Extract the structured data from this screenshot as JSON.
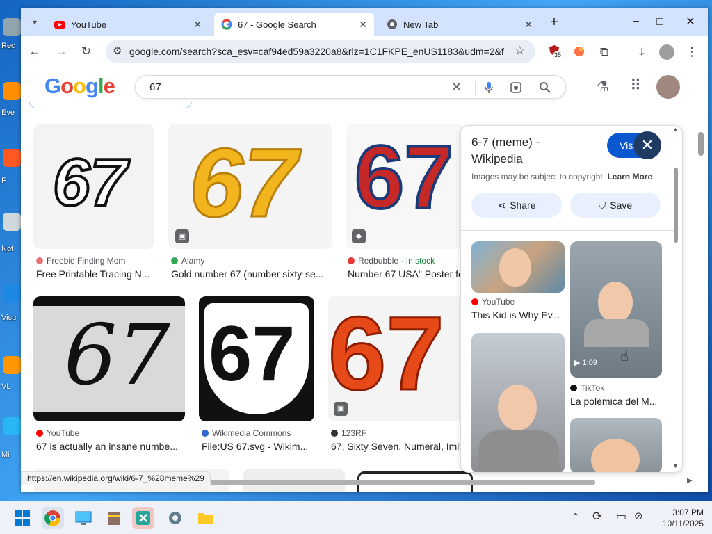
{
  "desktop": {
    "icons": [
      {
        "label": "Rec"
      },
      {
        "label": "Eve"
      },
      {
        "label": "F"
      },
      {
        "label": "Not"
      },
      {
        "label": "Visu"
      },
      {
        "label": "VL"
      },
      {
        "label": "Mi"
      }
    ]
  },
  "browser": {
    "tabs": [
      {
        "label": "YouTube"
      },
      {
        "label": "67 - Google Search"
      },
      {
        "label": "New Tab"
      }
    ],
    "new_tab_symbol": "+",
    "url": "google.com/search?sca_esv=caf94ed59a3220a8&rlz=1C1FKPE_enUS1183&udm=2&f...",
    "extension_badge": "35",
    "window_controls": {
      "minimize": "−",
      "maximize": "□",
      "close": "✕"
    }
  },
  "search": {
    "logo": "Google",
    "query": "67"
  },
  "results": [
    {
      "source": "Freebie Finding Mom",
      "title": "Free Printable Tracing N...",
      "image_text": "67",
      "dot_color": "#e57373"
    },
    {
      "source": "Alamy",
      "title": "Gold number 67 (number sixty-se...",
      "image_text": "67",
      "dot_color": "#34a853"
    },
    {
      "source": "Redbubble",
      "extra": "· In stock",
      "title": "Number 67 USA\" Poster fo",
      "image_text": "67",
      "dot_color": "#e53935"
    },
    {
      "source": "YouTube",
      "title": "67 is actually an insane numbe...",
      "image_text": "67",
      "dot_color": "#ff0000"
    },
    {
      "source": "Wikimedia Commons",
      "title": "File:US 67.svg - Wikim...",
      "image_text": "67",
      "dot_color": "#3366cc"
    },
    {
      "source": "123RF",
      "title": "67, Sixty Seven, Numeral, Imit",
      "image_text": "67",
      "dot_color": "#333333"
    }
  ],
  "panel": {
    "title_line1": "6-7 (meme) -",
    "title_line2": "Wikipedia",
    "visit_label": "Visit",
    "copyright": "Images may be subject to copyright.",
    "learn_more": "Learn More",
    "share_label": "Share",
    "save_label": "Save",
    "related": [
      {
        "source": "YouTube",
        "title": "This Kid is Why Ev..."
      },
      {
        "source": "TikTok",
        "title": "La polémica del M...",
        "duration": "1:09"
      }
    ]
  },
  "status_url": "https://en.wikipedia.org/wiki/6-7_%28meme%29",
  "taskbar": {
    "time": "3:07 PM",
    "date": "10/11/2025"
  },
  "colors": {
    "tabstrip": "#d3e3fd",
    "accent_blue": "#0b57d0",
    "panel_button": "#e8f0fe"
  }
}
